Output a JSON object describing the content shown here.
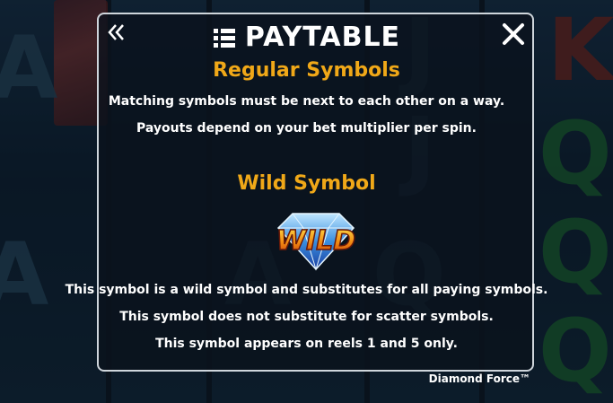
{
  "paytable": {
    "title": "PAYTABLE",
    "regular_heading": "Regular Symbols",
    "regular_lines": [
      "Matching symbols must be next to each other on a way.",
      "Payouts depend on your bet multiplier per spin."
    ],
    "wild_heading": "Wild Symbol",
    "wild_symbol_text": "WILD",
    "wild_lines": [
      "This symbol is a wild symbol and substitutes for all paying symbols.",
      "This symbol does not substitute for scatter symbols.",
      "This symbol appears on reels 1 and 5 only."
    ]
  },
  "brand": "Diamond Force™",
  "icons": {
    "back": "double-chevron-left-icon",
    "close": "close-icon",
    "title": "list-icon"
  },
  "colors": {
    "heading": "#f0a818",
    "text": "#ffffff",
    "border": "#cfd6dc"
  }
}
